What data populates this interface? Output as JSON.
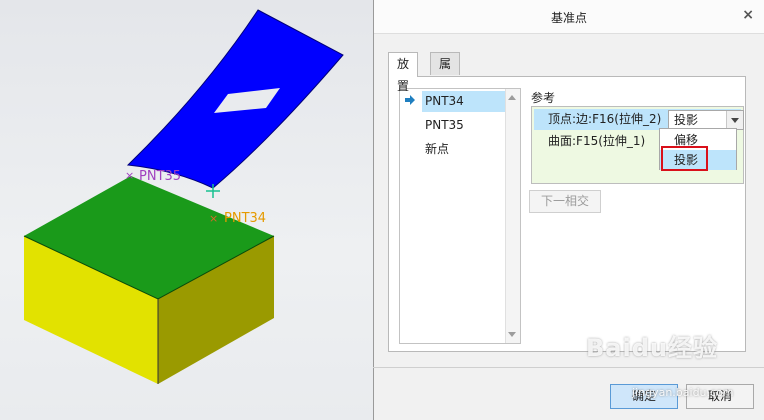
{
  "viewport": {
    "points": [
      {
        "label": "PNT35",
        "color": "#a040c0"
      },
      {
        "label": "PNT34",
        "color": "#e59a00"
      }
    ],
    "colors": {
      "surface": "#0000ff",
      "block_top": "#1a9a1a",
      "block_left": "#e2e200",
      "block_right": "#9a9a00"
    }
  },
  "dialog": {
    "title": "基准点",
    "close_label": "×",
    "tabs": [
      {
        "label": "放置",
        "active": true
      },
      {
        "label": "属性",
        "active": false
      }
    ],
    "points_list": [
      {
        "label": "PNT34",
        "selected": true
      },
      {
        "label": "PNT35",
        "selected": false
      },
      {
        "label": "新点",
        "selected": false
      }
    ],
    "references": {
      "label": "参考",
      "rows": [
        {
          "text": "顶点:边:F16(拉伸_2)",
          "constraint": "投影"
        },
        {
          "text": "曲面:F15(拉伸_1)"
        }
      ],
      "dropdown_options": [
        {
          "label": "偏移",
          "highlighted": false
        },
        {
          "label": "投影",
          "highlighted": true
        }
      ]
    },
    "next_intersection_label": "下一相交",
    "ok_label": "确定",
    "cancel_label": "取消"
  },
  "watermark": {
    "main": "Baidu经验",
    "sub": "jingyan.baidu.com"
  }
}
